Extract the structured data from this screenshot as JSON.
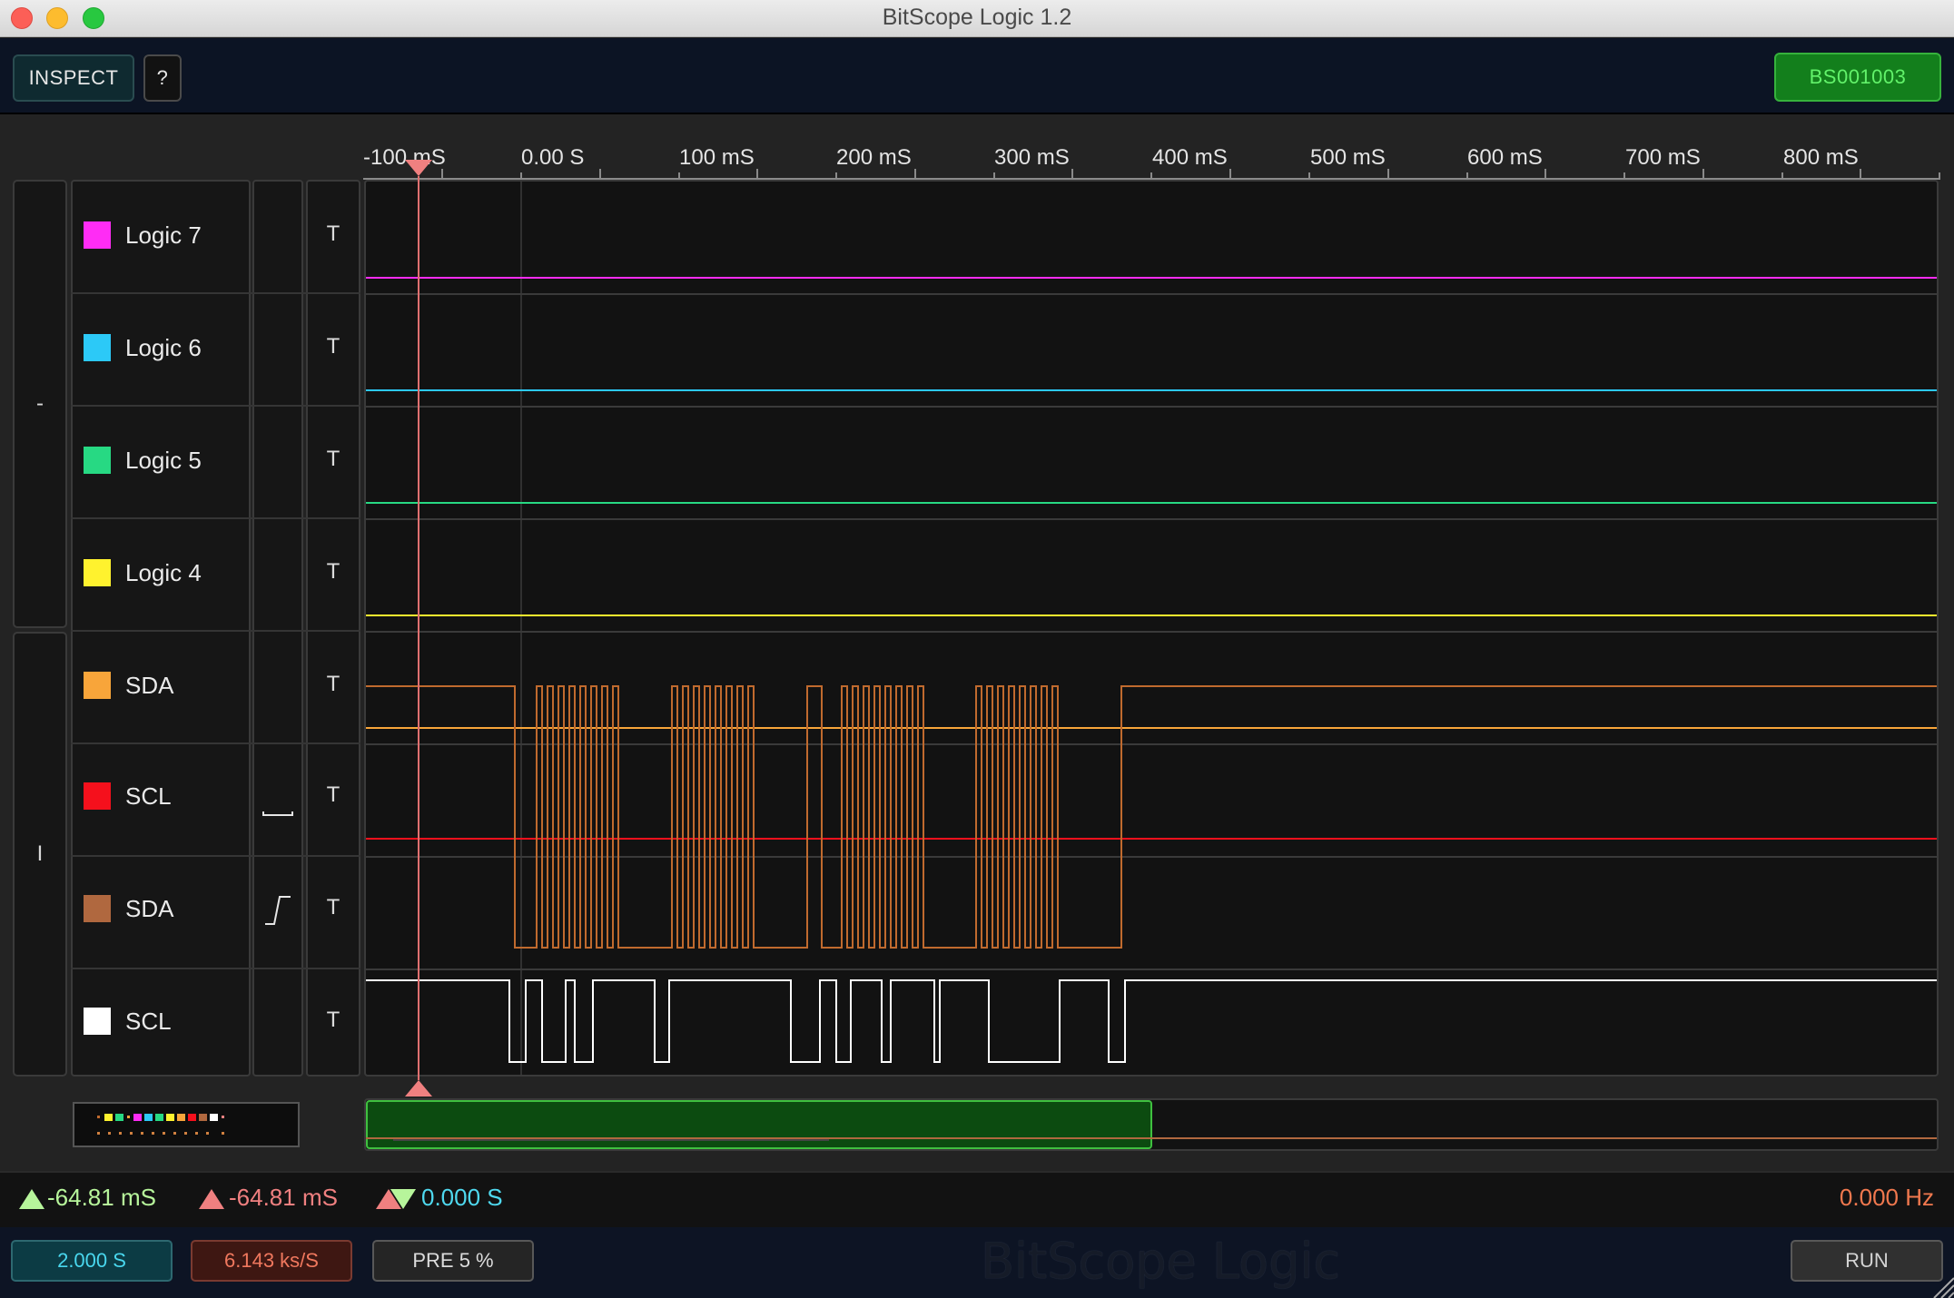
{
  "window": {
    "title": "BitScope Logic 1.2"
  },
  "toolbar": {
    "inspect_label": "INSPECT",
    "help_label": "?",
    "device_label": "BS001003"
  },
  "timeline": {
    "labels": [
      "-100 mS",
      "0.00  S",
      "100 mS",
      "200 mS",
      "300 mS",
      "400 mS",
      "500 mS",
      "600 mS",
      "700 mS",
      "800 mS"
    ]
  },
  "groups": {
    "top_label": "-",
    "bottom_label": "I"
  },
  "channels": [
    {
      "name": "Logic 7",
      "color": "#ff2cf5",
      "trigger": "T"
    },
    {
      "name": "Logic 6",
      "color": "#2cc9f7",
      "trigger": "T"
    },
    {
      "name": "Logic 5",
      "color": "#27d983",
      "trigger": "T"
    },
    {
      "name": "Logic 4",
      "color": "#fff22e",
      "trigger": "T"
    },
    {
      "name": "SDA",
      "color": "#f8a53a",
      "trigger": "T"
    },
    {
      "name": "SCL",
      "color": "#f5101c",
      "trigger": "T",
      "edge": "falling-edge"
    },
    {
      "name": "SDA",
      "color": "#b0683f",
      "trigger": "T",
      "edge": "rising-edge"
    },
    {
      "name": "SCL",
      "color": "#ffffff",
      "trigger": "T"
    }
  ],
  "status": {
    "cursor_a": "-64.81 mS",
    "cursor_b": "-64.81 mS",
    "delta": "0.000  S",
    "frequency": "0.000  Hz",
    "colors": {
      "cursor_a": "#b7f59b",
      "cursor_b": "#f08080",
      "delta": "#4fd9ef",
      "frequency": "#f0784e"
    }
  },
  "bottom": {
    "duration": "2.000  S",
    "sample_rate": "6.143 ks/S",
    "pre_trigger": "PRE  5 %",
    "brand": "BitScope Logic",
    "run_label": "RUN"
  }
}
